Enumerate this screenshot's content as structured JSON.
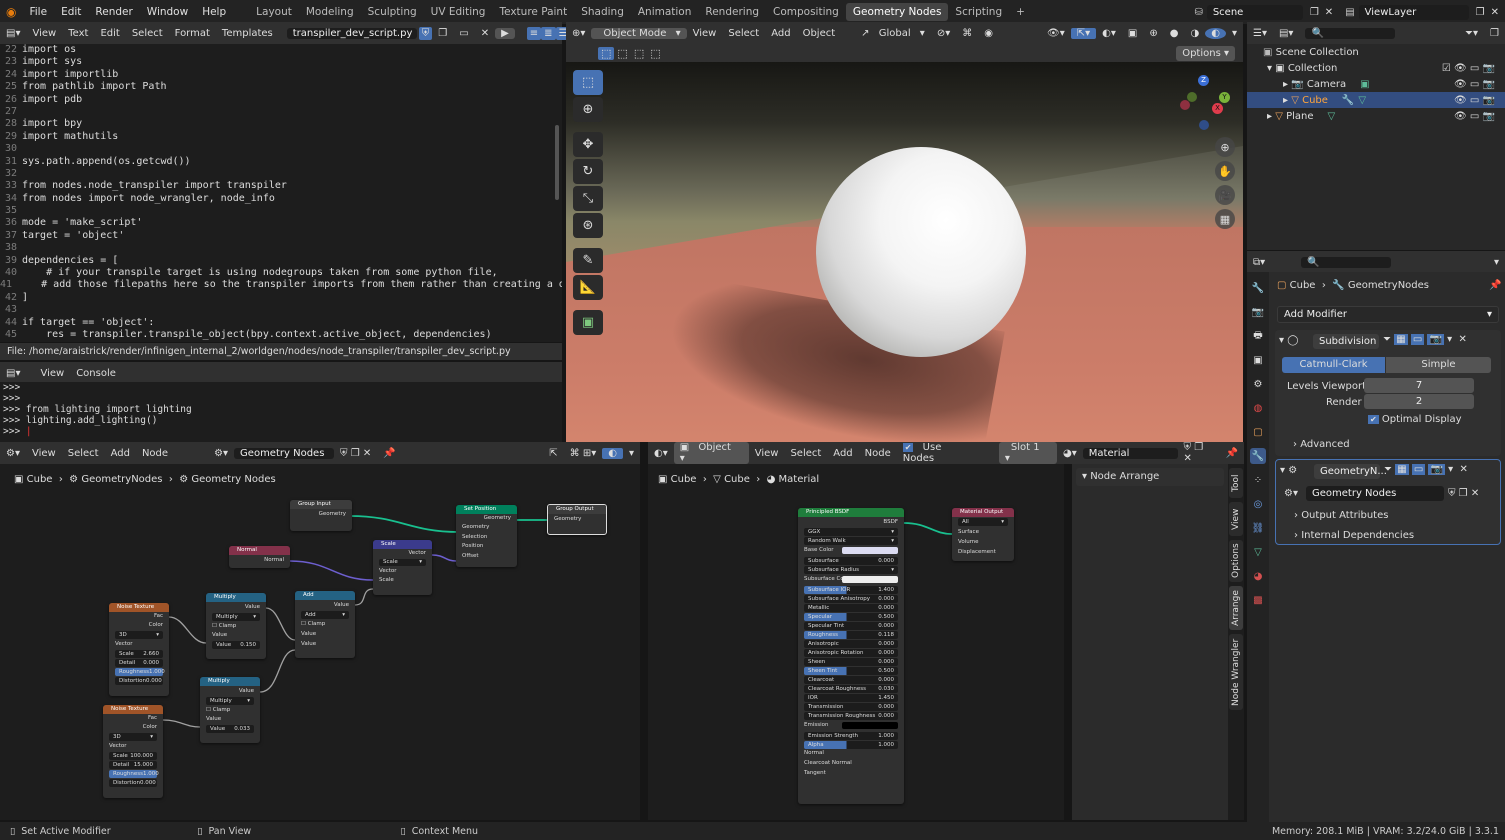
{
  "menu": [
    "File",
    "Edit",
    "Render",
    "Window",
    "Help"
  ],
  "workspaces": [
    "Layout",
    "Modeling",
    "Sculpting",
    "UV Editing",
    "Texture Paint",
    "Shading",
    "Animation",
    "Rendering",
    "Compositing",
    "Geometry Nodes",
    "Scripting"
  ],
  "active_workspace": "Geometry Nodes",
  "scene": "Scene",
  "view_layer": "ViewLayer",
  "text_editor": {
    "menu": [
      "View",
      "Text",
      "Edit",
      "Select",
      "Format",
      "Templates"
    ],
    "filename": "transpiler_dev_script.py",
    "lines": [
      [
        "22",
        "import os"
      ],
      [
        "23",
        "import sys"
      ],
      [
        "24",
        "import importlib"
      ],
      [
        "25",
        "from pathlib import Path"
      ],
      [
        "26",
        "import pdb"
      ],
      [
        "27",
        ""
      ],
      [
        "28",
        "import bpy"
      ],
      [
        "29",
        "import mathutils"
      ],
      [
        "30",
        ""
      ],
      [
        "31",
        "sys.path.append(os.getcwd())"
      ],
      [
        "32",
        ""
      ],
      [
        "33",
        "from nodes.node_transpiler import transpiler"
      ],
      [
        "34",
        "from nodes import node_wrangler, node_info"
      ],
      [
        "35",
        ""
      ],
      [
        "36",
        "mode = 'make_script'"
      ],
      [
        "37",
        "target = 'object'"
      ],
      [
        "38",
        ""
      ],
      [
        "39",
        "dependencies = ["
      ],
      [
        "40",
        "    # if your transpile target is using nodegroups taken from some python file,"
      ],
      [
        "41",
        "    # add those filepaths here so the transpiler imports from them rather than creating a dupl"
      ],
      [
        "42",
        "]"
      ],
      [
        "43",
        ""
      ],
      [
        "44",
        "if target == 'object':"
      ],
      [
        "45",
        "    res = transpiler.transpile_object(bpy.context.active_object, dependencies)"
      ]
    ],
    "filepath": "File: /home/araistrick/render/infinigen_internal_2/worldgen/nodes/node_transpiler/transpiler_dev_script.py"
  },
  "console": {
    "menu": [
      "View",
      "Console"
    ],
    "lines": [
      ">>>",
      ">>>",
      ">>> from lighting import lighting",
      ">>> lighting.add_lighting()",
      ">>> "
    ]
  },
  "viewport": {
    "mode": "Object Mode",
    "menu": [
      "View",
      "Select",
      "Add",
      "Object"
    ],
    "orientation": "Global",
    "options": "Options"
  },
  "outliner": {
    "rows": [
      "Scene Collection",
      "Collection",
      "Camera",
      "Cube",
      "Plane"
    ]
  },
  "properties": {
    "breadcrumb": [
      "Cube",
      "GeometryNodes"
    ],
    "add_modifier": "Add Modifier",
    "subdivision": {
      "name": "Subdivision",
      "catmull": "Catmull-Clark",
      "simple": "Simple",
      "levels_label": "Levels Viewport",
      "levels": "7",
      "render_label": "Render",
      "render": "2",
      "optimal": "Optimal Display",
      "advanced": "Advanced"
    },
    "geonodes": {
      "name": "GeometryN...",
      "group": "Geometry Nodes",
      "output_attr": "Output Attributes",
      "internal_dep": "Internal Dependencies"
    }
  },
  "node_editor": {
    "type": "Geometry Nodes",
    "menu": [
      "View",
      "Select",
      "Add",
      "Node"
    ],
    "breadcrumb": [
      "Cube",
      "GeometryNodes",
      "Geometry Nodes"
    ]
  },
  "shader_editor": {
    "object": "Object",
    "menu": [
      "View",
      "Select",
      "Add",
      "Node"
    ],
    "use_nodes": "Use Nodes",
    "slot": "Slot 1",
    "material": "Material",
    "breadcrumb": [
      "Cube",
      "Cube",
      "Material"
    ]
  },
  "sidebar": {
    "panel": "Node Arrange",
    "tabs": [
      "Tool",
      "View",
      "Options",
      "Arrange",
      "Node Wrangler"
    ]
  },
  "geo_nodes": {
    "group_input": {
      "title": "Group Input",
      "out": "Geometry"
    },
    "group_output": {
      "title": "Group Output",
      "in": "Geometry"
    },
    "set_position": {
      "title": "Set Position",
      "out": "Geometry",
      "ins": [
        "Geometry",
        "Selection",
        "Position",
        "Offset"
      ]
    },
    "scale": {
      "title": "Scale",
      "out": "Vector",
      "mode": "Scale",
      "ins": [
        "Vector",
        "Scale"
      ]
    },
    "normal": {
      "title": "Normal",
      "out": "Normal"
    },
    "add": {
      "title": "Add",
      "out": "Value",
      "mode": "Add",
      "clamp": "Clamp",
      "ins": [
        "Value",
        "Value"
      ]
    },
    "multiply1": {
      "title": "Multiply",
      "out": "Value",
      "mode": "Multiply",
      "clamp": "Clamp",
      "in": "Value",
      "val_label": "Value",
      "val": "0.150"
    },
    "multiply2": {
      "title": "Multiply",
      "out": "Value",
      "mode": "Multiply",
      "clamp": "Clamp",
      "in": "Value",
      "val_label": "Value",
      "val": "0.033"
    },
    "noise1": {
      "title": "Noise Texture",
      "outs": [
        "Fac",
        "Color"
      ],
      "dim": "3D",
      "vec": "Vector",
      "fields": [
        [
          "Scale",
          "2.660"
        ],
        [
          "Detail",
          "0.000"
        ],
        [
          "Roughness",
          "1.000"
        ],
        [
          "Distortion",
          "0.000"
        ]
      ]
    },
    "noise2": {
      "title": "Noise Texture",
      "outs": [
        "Fac",
        "Color"
      ],
      "dim": "3D",
      "vec": "Vector",
      "fields": [
        [
          "Scale",
          "100.000"
        ],
        [
          "Detail",
          "15.000"
        ],
        [
          "Roughness",
          "1.000"
        ],
        [
          "Distortion",
          "0.000"
        ]
      ]
    }
  },
  "shader_nodes": {
    "bsdf": {
      "title": "Principled BSDF",
      "out": "BSDF",
      "dist": "GGX",
      "sss": "Random Walk",
      "rows": [
        [
          "Base Color",
          ""
        ],
        [
          "Subsurface",
          "0.000"
        ],
        [
          "Subsurface Radius",
          ""
        ],
        [
          "Subsurface Colo",
          ""
        ],
        [
          "Subsurface IOR",
          "1.400"
        ],
        [
          "Subsurface Anisotropy",
          "0.000"
        ],
        [
          "Metallic",
          "0.000"
        ],
        [
          "Specular",
          "0.500"
        ],
        [
          "Specular Tint",
          "0.000"
        ],
        [
          "Roughness",
          "0.118"
        ],
        [
          "Anisotropic",
          "0.000"
        ],
        [
          "Anisotropic Rotation",
          "0.000"
        ],
        [
          "Sheen",
          "0.000"
        ],
        [
          "Sheen Tint",
          "0.500"
        ],
        [
          "Clearcoat",
          "0.000"
        ],
        [
          "Clearcoat Roughness",
          "0.030"
        ],
        [
          "IOR",
          "1.450"
        ],
        [
          "Transmission",
          "0.000"
        ],
        [
          "Transmission Roughness",
          "0.000"
        ],
        [
          "Emission",
          ""
        ],
        [
          "Emission Strength",
          "1.000"
        ],
        [
          "Alpha",
          "1.000"
        ],
        [
          "Normal",
          ""
        ],
        [
          "Clearcoat Normal",
          ""
        ],
        [
          "Tangent",
          ""
        ]
      ]
    },
    "output": {
      "title": "Material Output",
      "target": "All",
      "ins": [
        "Surface",
        "Volume",
        "Displacement"
      ]
    }
  },
  "status": {
    "left": "Set Active Modifier",
    "mid": "Pan View",
    "ctx": "Context Menu",
    "right": "Memory: 208.1 MiB | VRAM: 3.2/24.0 GiB | 3.3.1"
  }
}
